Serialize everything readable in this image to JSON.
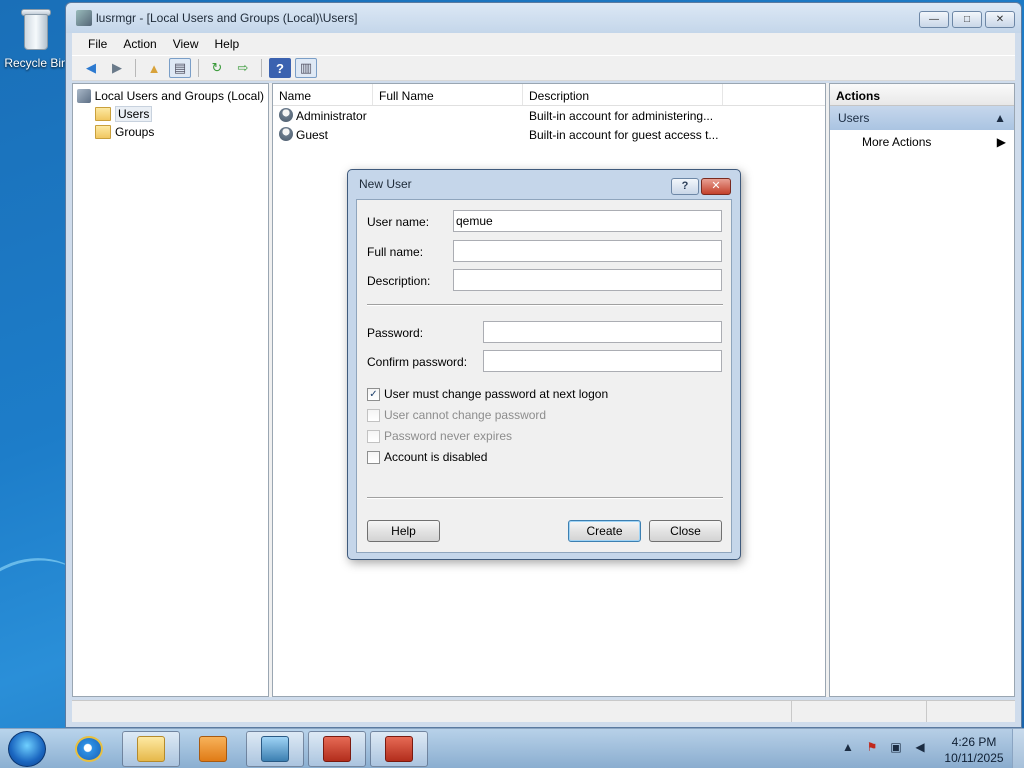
{
  "desktop": {
    "recycle_bin_label": "Recycle Bin"
  },
  "window": {
    "title": "lusrmgr - [Local Users and Groups (Local)\\Users]",
    "controls": {
      "minimize": "—",
      "maximize": "□",
      "close": "✕"
    }
  },
  "menu": {
    "file": "File",
    "action": "Action",
    "view": "View",
    "help": "Help"
  },
  "tree": {
    "root": "Local Users and Groups (Local)",
    "users": "Users",
    "groups": "Groups"
  },
  "list": {
    "columns": {
      "name": "Name",
      "full_name": "Full Name",
      "description": "Description"
    },
    "rows": [
      {
        "name": "Administrator",
        "full_name": "",
        "description": "Built-in account for administering..."
      },
      {
        "name": "Guest",
        "full_name": "",
        "description": "Built-in account for guest access t..."
      }
    ]
  },
  "actions": {
    "title": "Actions",
    "section": "Users",
    "more_actions": "More Actions"
  },
  "dialog": {
    "title": "New User",
    "help_glyph": "?",
    "close_glyph": "✕",
    "user_name_label": "User name:",
    "user_name_value": "qemue",
    "full_name_label": "Full name:",
    "full_name_value": "",
    "description_label": "Description:",
    "description_value": "",
    "password_label": "Password:",
    "confirm_password_label": "Confirm password:",
    "checkboxes": {
      "must_change": {
        "label": "User must change password at next logon",
        "checked": true,
        "enabled": true
      },
      "cannot_change": {
        "label": "User cannot change password",
        "checked": false,
        "enabled": false
      },
      "never_expires": {
        "label": "Password never expires",
        "checked": false,
        "enabled": false
      },
      "disabled": {
        "label": "Account is disabled",
        "checked": false,
        "enabled": true
      }
    },
    "help_button": "Help",
    "create_button": "Create",
    "close_button": "Close"
  },
  "taskbar": {
    "clock_time": "4:26 PM",
    "clock_date": "10/11/2025",
    "tray_arrow": "▲"
  }
}
